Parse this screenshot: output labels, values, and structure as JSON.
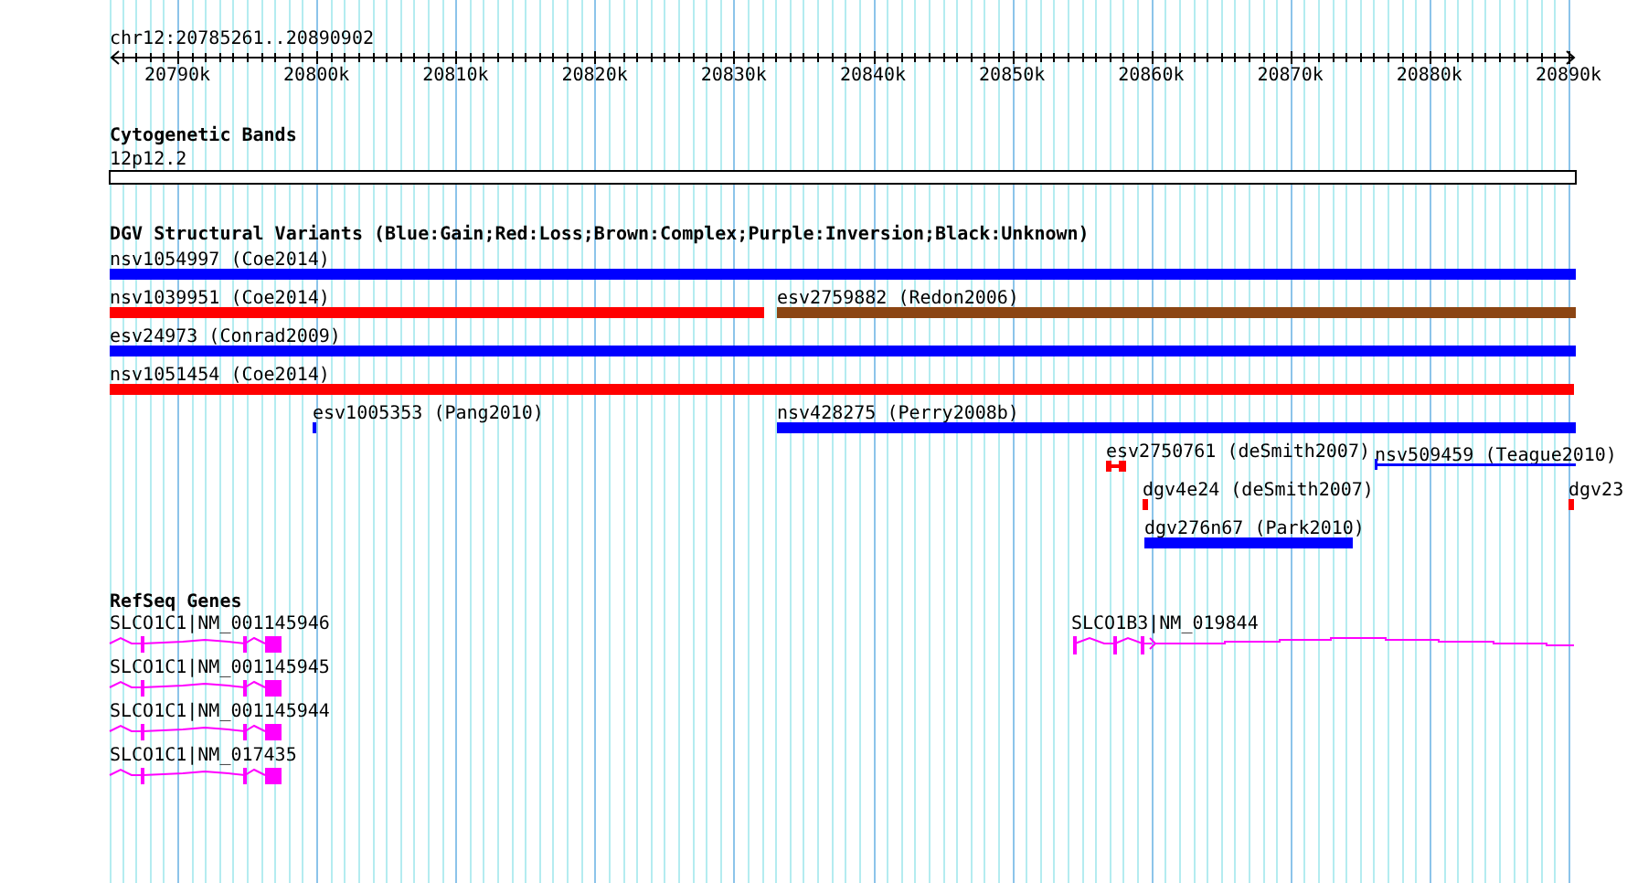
{
  "ruler": {
    "title": "chr12:20785261..20890902",
    "ticks": [
      "20790k",
      "20800k",
      "20810k",
      "20820k",
      "20830k",
      "20840k",
      "20850k",
      "20860k",
      "20870k",
      "20880k",
      "20890k"
    ]
  },
  "tracks": [
    {
      "kind": "bands",
      "title": "Cytogenetic Bands",
      "features": [
        {
          "label": "12p12.2"
        }
      ]
    },
    {
      "kind": "variants",
      "title": "DGV Structural Variants (Blue:Gain;Red:Loss;Brown:Complex;Purple:Inversion;Black:Unknown)",
      "features": [
        {
          "label": "nsv1054997 (Coe2014)",
          "color": "#0000ff"
        },
        {
          "label": "nsv1039951 (Coe2014)",
          "color": "#ff0000"
        },
        {
          "label": "esv2759882 (Redon2006)",
          "color": "#8b4513"
        },
        {
          "label": "esv24973 (Conrad2009)",
          "color": "#0000ff"
        },
        {
          "label": "nsv1051454 (Coe2014)",
          "color": "#ff0000"
        },
        {
          "label": "esv1005353 (Pang2010)",
          "color": "#0000ff"
        },
        {
          "label": "nsv428275 (Perry2008b)",
          "color": "#0000ff"
        },
        {
          "label": "esv2750761 (deSmith2007)",
          "color": "#ff0000"
        },
        {
          "label": "nsv509459 (Teague2010)",
          "color": "#0000ff"
        },
        {
          "label": "dgv4e24 (deSmith2007)",
          "color": "#ff0000"
        },
        {
          "label": "dgv23",
          "color": "#ff0000"
        },
        {
          "label": "dgv276n67 (Park2010)",
          "color": "#0000ff"
        }
      ]
    },
    {
      "kind": "genes",
      "title": "RefSeq Genes",
      "features": [
        {
          "label": "SLCO1C1|NM_001145946"
        },
        {
          "label": "SLCO1C1|NM_001145945"
        },
        {
          "label": "SLCO1C1|NM_001145944"
        },
        {
          "label": "SLCO1C1|NM_017435"
        },
        {
          "label": "SLCO1B3|NM_019844"
        }
      ]
    }
  ]
}
